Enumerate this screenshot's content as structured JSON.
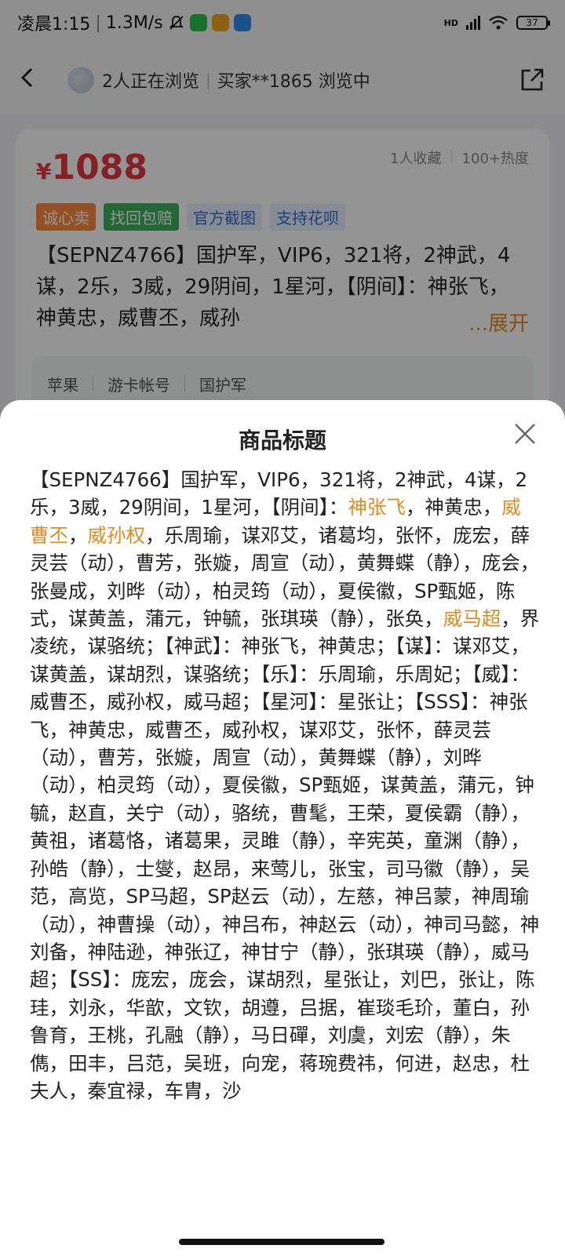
{
  "status_bar": {
    "time": "凌晨1:15",
    "speed": "1.3M/s",
    "battery": "37",
    "net": "HD"
  },
  "header": {
    "viewers": "2人正在浏览",
    "buyer": "买家**1865 浏览中"
  },
  "card": {
    "currency": "¥",
    "price": "1088",
    "favorites": "1人收藏",
    "heat": "100+热度",
    "tags": [
      "诚心卖",
      "找回包赔",
      "官方截图",
      "支持花呗"
    ],
    "title": "【SEPNZ4766】国护军，VIP6，321将，2神武，4谋，2乐，3威，29阴间，1星河，【阴间】：神张飞，神黄忠，威曹丕，威孙",
    "expand": "...展开",
    "meta": [
      "苹果",
      "游卡帐号",
      "国护军"
    ]
  },
  "sheet": {
    "title": "商品标题",
    "segments": [
      {
        "t": "【SEPNZ4766】国护军，VIP6，321将，2神武，4谋，2乐，3威，29阴间，1星河，【阴间】：",
        "h": false
      },
      {
        "t": "神张飞",
        "h": true
      },
      {
        "t": "，神黄忠，",
        "h": false
      },
      {
        "t": "威曹丕",
        "h": true
      },
      {
        "t": "，",
        "h": false
      },
      {
        "t": "威孙权",
        "h": true
      },
      {
        "t": "，乐周瑜，谋邓艾，诸葛均，张怀，庞宏，薛灵芸（动），曹芳，张嫙，周宣（动），黄舞蝶（静），庞会，张曼成，刘晔（动），柏灵筠（动），夏侯徽，SP甄姬，陈式，谋黄盖，蒲元，钟毓，张琪瑛（静），张奂，",
        "h": false
      },
      {
        "t": "威马超",
        "h": true
      },
      {
        "t": "，界凌统，谋骆统；【神武】：神张飞，神黄忠；【谋】：谋邓艾，谋黄盖，谋胡烈，谋骆统；【乐】：乐周瑜，乐周妃；【威】：威曹丕，威孙权，威马超；【星河】：星张让；【SSS】：神张飞，神黄忠，威曹丕，威孙权，谋邓艾，张怀，薛灵芸（动），曹芳，张嫙，周宣（动），黄舞蝶（静），刘晔（动），柏灵筠（动），夏侯徽，SP甄姬，谋黄盖，蒲元，钟毓，赵直，关宁（动），骆统，曹髦，王荣，夏侯霸（静），黄祖，诸葛恪，诸葛果，灵雎（静），辛宪英，童渊（静），孙皓（静），士燮，赵昂，来莺儿，张宝，司马徽（静），吴范，高览，SP马超，SP赵云（动），左慈，神吕蒙，神周瑜（动），神曹操（动），神吕布，神赵云（动），神司马懿，神刘备，神陆逊，神张辽，神甘宁（静），张琪瑛（静），威马超；【SS】：庞宏，庞会，谋胡烈，星张让，刘巴，张让，陈珪，刘永，华歆，文钦，胡遵，吕据，崔琰毛玠，董白，孙鲁育，王桃，孔融（静），马日磾，刘虞，刘宏（静），朱儁，田丰，吕范，吴班，向宠，蒋琬费祎，何进，赵忠，杜夫人，秦宜禄，车胄，沙",
        "h": false
      }
    ]
  },
  "colors": {
    "price": "#e8373e",
    "highlight": "#e08a1c",
    "overlay": "rgba(0,0,0,0.42)"
  }
}
